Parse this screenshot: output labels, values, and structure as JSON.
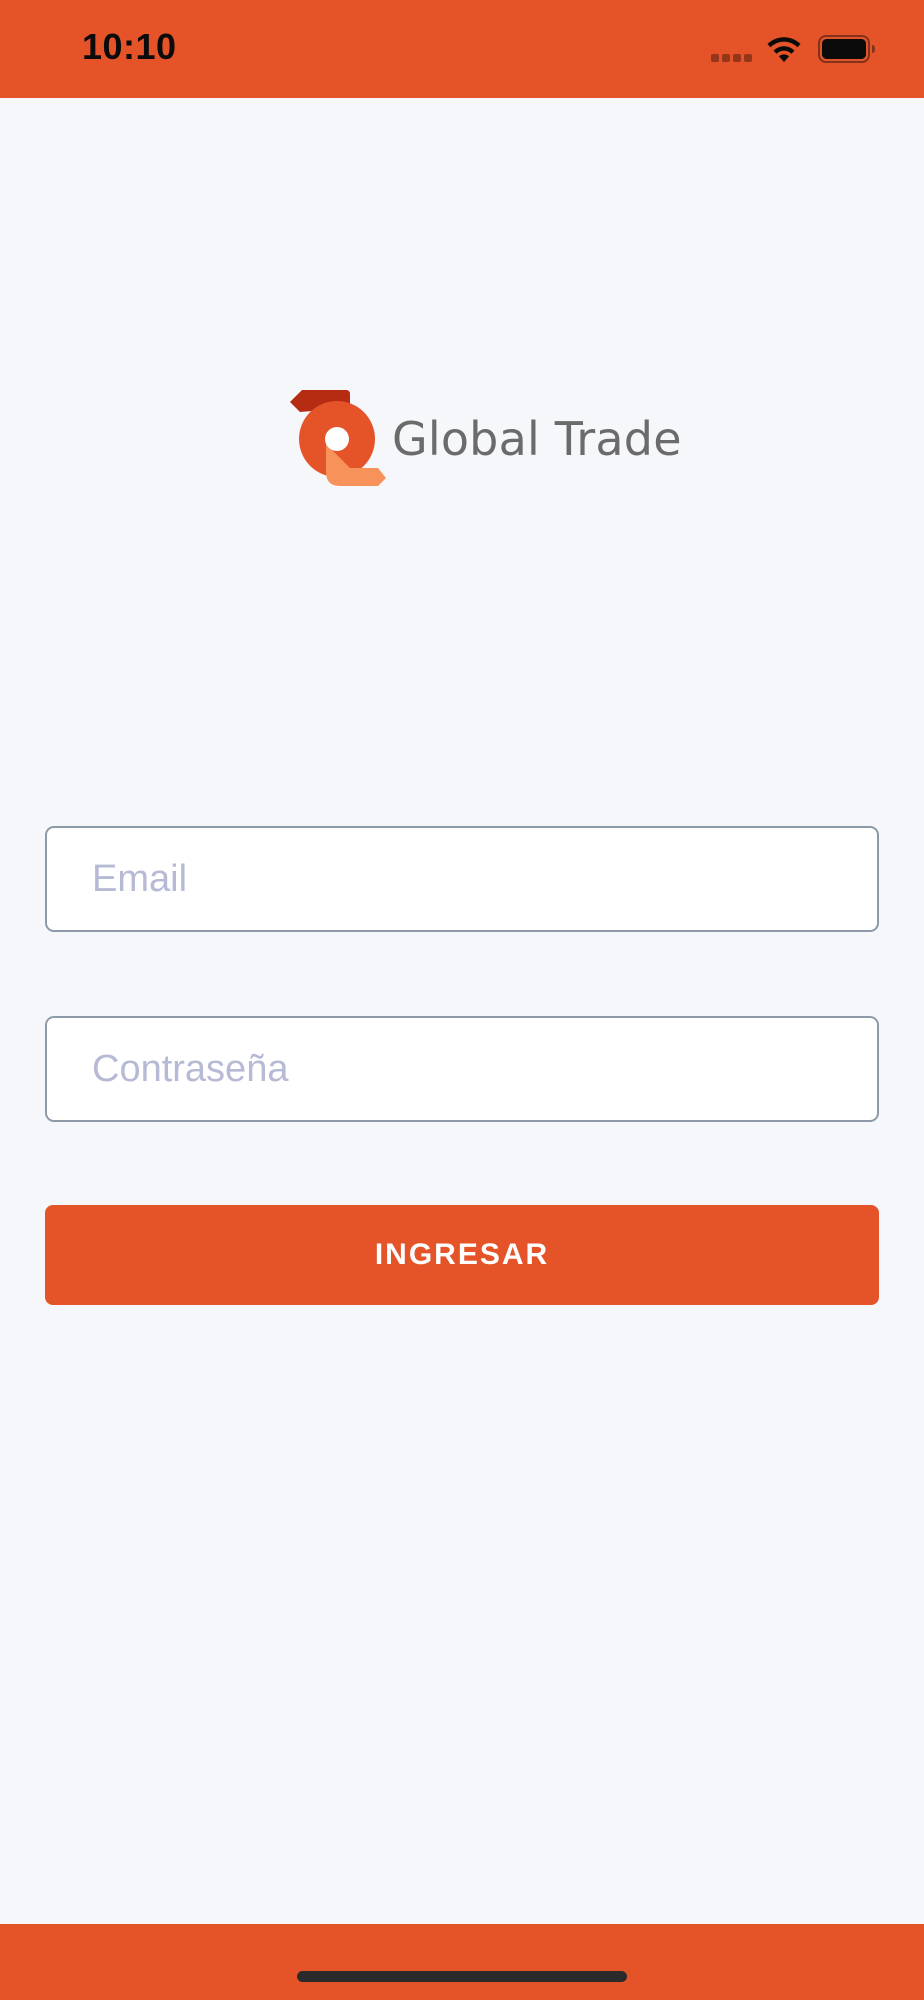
{
  "status_bar": {
    "time": "10:10"
  },
  "icons": {
    "signal": "cellular-signal-icon",
    "wifi": "wifi-icon",
    "battery": "battery-icon",
    "logo": "global-trade-logo-icon"
  },
  "logo": {
    "text": "Global Trade"
  },
  "form": {
    "email": {
      "placeholder": "Email",
      "value": ""
    },
    "password": {
      "placeholder": "Contraseña",
      "value": ""
    },
    "submit_label": "INGRESAR"
  },
  "colors": {
    "brand": "#E55328",
    "background": "#F6F7FB",
    "placeholder": "#B6BAD5",
    "logo_text": "#6B6B6B"
  }
}
